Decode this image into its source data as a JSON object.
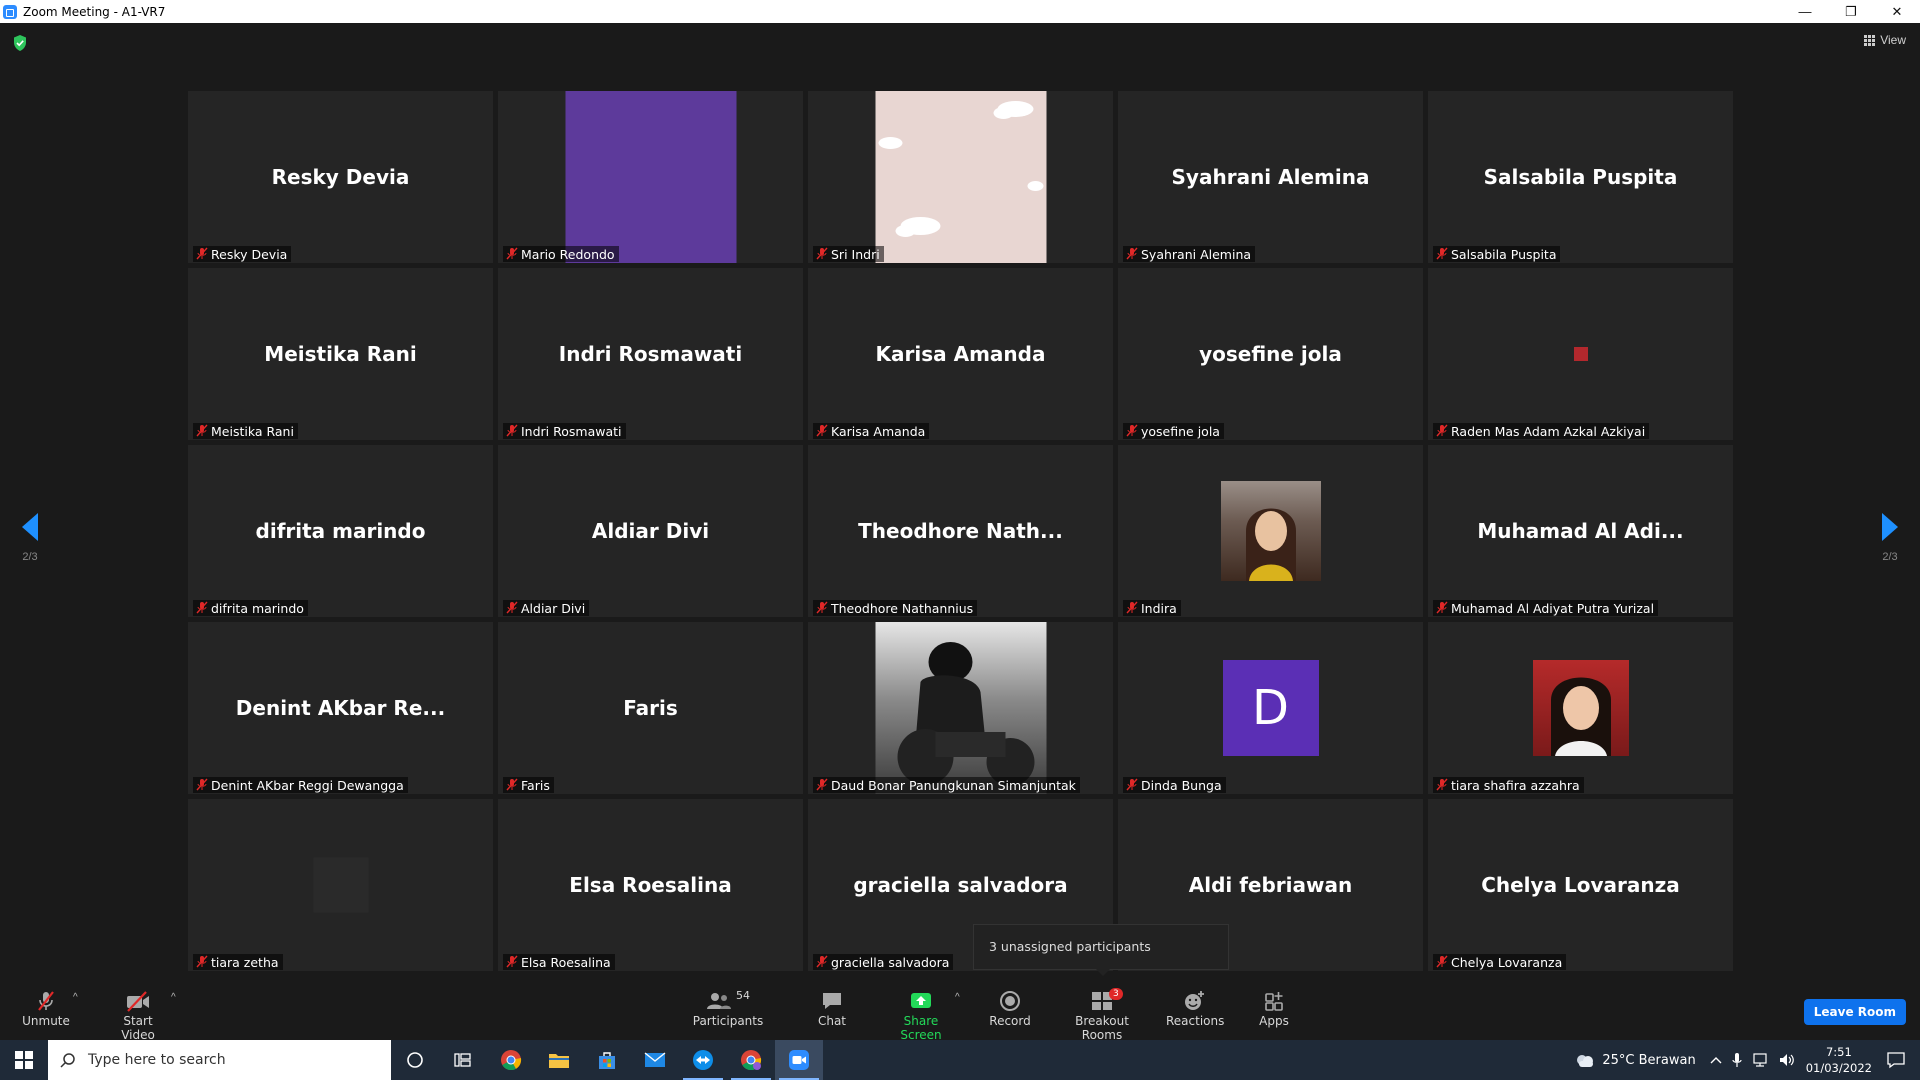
{
  "window": {
    "title": "Zoom Meeting - A1-VR7",
    "min_glyph": "—",
    "restore_glyph": "❐",
    "close_glyph": "✕"
  },
  "view": {
    "label": "View"
  },
  "pager": {
    "left": "2/3",
    "right": "2/3"
  },
  "tiles": [
    {
      "big": "Resky Devia",
      "label": "Resky Devia"
    },
    {
      "big": "",
      "label": "Mario Redondo",
      "avatar": "purple-square"
    },
    {
      "big": "",
      "label": "Sri Indri",
      "avatar": "clouds-image"
    },
    {
      "big": "Syahrani Alemina",
      "label": "Syahrani Alemina"
    },
    {
      "big": "Salsabila Puspita",
      "label": "Salsabila Puspita"
    },
    {
      "big": "Meistika Rani",
      "label": "Meistika Rani"
    },
    {
      "big": "Indri Rosmawati",
      "label": "Indri Rosmawati"
    },
    {
      "big": "Karisa Amanda",
      "label": "Karisa Amanda"
    },
    {
      "big": "yosefine jola",
      "label": "yosefine jola"
    },
    {
      "big": "",
      "label": "Raden Mas Adam Azkal Azkiyai",
      "avatar": "red-dot"
    },
    {
      "big": "difrita marindo",
      "label": "difrita marindo"
    },
    {
      "big": "Aldiar Divi",
      "label": "Aldiar Divi"
    },
    {
      "big": "Theodhore  Nath...",
      "label": "Theodhore Nathannius"
    },
    {
      "big": "",
      "label": "Indira",
      "avatar": "photo-girl"
    },
    {
      "big": "Muhamad  Al  Adi...",
      "label": "Muhamad Al Adiyat Putra Yurizal"
    },
    {
      "big": "Denint  AKbar  Re...",
      "label": "Denint AKbar Reggi Dewangga"
    },
    {
      "big": "Faris",
      "label": "Faris"
    },
    {
      "big": "",
      "label": "Daud Bonar Panungkunan Simanjuntak",
      "avatar": "photo-motorbike"
    },
    {
      "big": "",
      "label": "Dinda Bunga",
      "avatar": "letter-d",
      "letter": "D"
    },
    {
      "big": "",
      "label": "tiara shafira azzahra",
      "avatar": "photo-girl2"
    },
    {
      "big": "",
      "label": "tiara zetha",
      "avatar": "dark-square"
    },
    {
      "big": "Elsa Roesalina",
      "label": "Elsa Roesalina"
    },
    {
      "big": "graciella salvadora",
      "label": "graciella salvadora"
    },
    {
      "big": "Aldi febriawan",
      "label": ""
    },
    {
      "big": "Chelya Lovaranza",
      "label": "Chelya Lovaranza"
    }
  ],
  "tooltip": "3 unassigned participants",
  "toolbar": {
    "unmute": "Unmute",
    "start_video": "Start Video",
    "participants": "Participants",
    "participants_count": "54",
    "chat": "Chat",
    "share_screen": "Share Screen",
    "record": "Record",
    "breakout_rooms": "Breakout Rooms",
    "breakout_badge": "3",
    "reactions": "Reactions",
    "apps": "Apps",
    "leave": "Leave Room",
    "caret": "^"
  },
  "taskbar": {
    "search_placeholder": "Type here to search",
    "weather": "25°C  Berawan",
    "time": "7:51",
    "date": "01/03/2022"
  },
  "colors": {
    "accent": "#0e72ed",
    "share_green": "#23d959",
    "mute_red": "#e02828",
    "tile_bg": "#252525"
  }
}
